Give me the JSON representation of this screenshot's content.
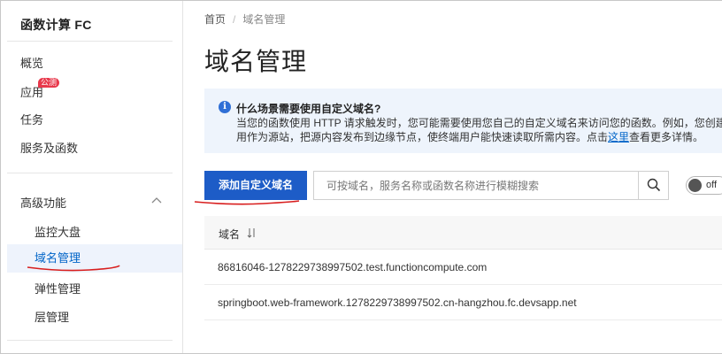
{
  "sidebar": {
    "brand": "函数计算 FC",
    "items": [
      {
        "label": "概览"
      },
      {
        "label": "应用",
        "badge": "公测"
      },
      {
        "label": "任务"
      },
      {
        "label": "服务及函数"
      }
    ],
    "section": {
      "title": "高级功能",
      "items": [
        {
          "label": "监控大盘"
        },
        {
          "label": "域名管理",
          "active": true
        },
        {
          "label": "弹性管理"
        },
        {
          "label": "层管理"
        }
      ]
    }
  },
  "breadcrumb": {
    "home": "首页",
    "separator": "/",
    "current": "域名管理"
  },
  "page_title": "域名管理",
  "info": {
    "icon": "info-icon",
    "title": "什么场景需要使用自定义域名?",
    "line1": "当您的函数使用 HTTP 请求触发时，您可能需要使用您自己的自定义域名来访问您的函数。例如，您创建",
    "line2_before": "用作为源站，把源内容发布到边缘节点，使终端用户能快速读取所需内容。点击",
    "link": "这里",
    "line2_after": "查看更多详情。"
  },
  "toolbar": {
    "add_label": "添加自定义域名",
    "search_placeholder": "可按域名，服务名称或函数名称进行模糊搜索",
    "toggle_label": "off"
  },
  "table": {
    "header": "域名",
    "rows": [
      "86816046-1278229738997502.test.functioncompute.com",
      "springboot.web-framework.1278229738997502.cn-hangzhou.fc.devsapp.net"
    ]
  },
  "colors": {
    "primary": "#1d5cc7",
    "link": "#0064c8",
    "badge": "#e8384b",
    "annotation": "#d81e1e",
    "info_bg": "#eef4fc"
  }
}
